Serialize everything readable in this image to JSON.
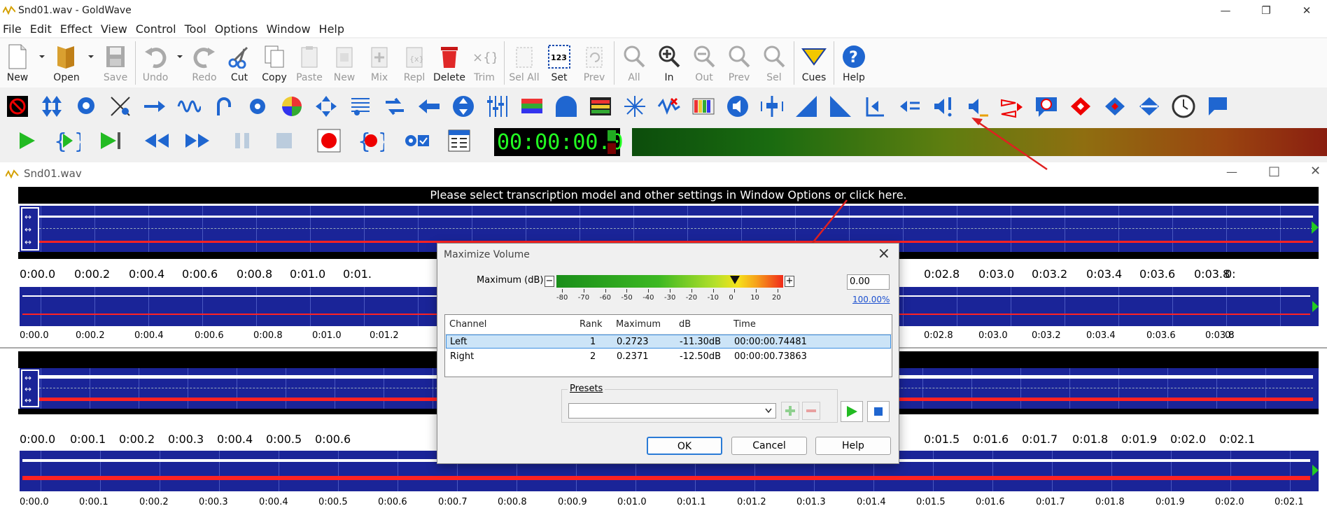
{
  "app": {
    "title": "Snd01.wav - GoldWave"
  },
  "menu": [
    "File",
    "Edit",
    "Effect",
    "View",
    "Control",
    "Tool",
    "Options",
    "Window",
    "Help"
  ],
  "toolbar": {
    "new": "New",
    "open": "Open",
    "save": "Save",
    "undo": "Undo",
    "redo": "Redo",
    "cut": "Cut",
    "copy": "Copy",
    "paste": "Paste",
    "new2": "New",
    "mix": "Mix",
    "repl": "Repl",
    "delete": "Delete",
    "trim": "Trim",
    "sel_all": "Sel All",
    "set": "Set",
    "prev": "Prev",
    "all": "All",
    "in": "In",
    "out": "Out",
    "prev2": "Prev",
    "sel": "Sel",
    "cues": "Cues",
    "help": "Help",
    "set_icon_text": "123"
  },
  "counter": {
    "time": "00:00:00.0"
  },
  "document": {
    "title": "Snd01.wav",
    "banner": "Please select transcription model and other settings in Window Options or click here."
  },
  "ruler1": [
    "0:00.0",
    "0:00.2",
    "0:00.4",
    "0:00.6",
    "0:00.8",
    "0:01.0",
    "0:01.",
    "0:02.8",
    "0:03.0",
    "0:03.2",
    "0:03.4",
    "0:03.6",
    "0:03.8",
    "0:"
  ],
  "ruler2": [
    "0:00.0",
    "0:00.2",
    "0:00.4",
    "0:00.6",
    "0:00.8",
    "0:01.0",
    "0:01.2",
    "0:02.8",
    "0:03.0",
    "0:03.2",
    "0:03.4",
    "0:03.6",
    "0:03.8",
    "0:"
  ],
  "ruler3": [
    "0:00.0",
    "0:00.1",
    "0:00.2",
    "0:00.3",
    "0:00.4",
    "0:00.5",
    "0:00.6",
    "0:01.5",
    "0:01.6",
    "0:01.7",
    "0:01.8",
    "0:01.9",
    "0:02.0",
    "0:02.1"
  ],
  "ruler4": [
    "0:00.0",
    "0:00.1",
    "0:00.2",
    "0:00.3",
    "0:00.4",
    "0:00.5",
    "0:00.6",
    "0:00.7",
    "0:00.8",
    "0:00.9",
    "0:01.0",
    "0:01.1",
    "0:01.2",
    "0:01.3",
    "0:01.4",
    "0:01.5",
    "0:01.6",
    "0:01.7",
    "0:01.8",
    "0:01.9",
    "0:02.0",
    "0:02.1"
  ],
  "dialog": {
    "title": "Maximize Volume",
    "max_label": "Maximum (dB):",
    "minus": "−",
    "plus": "+",
    "max_value": "0.00",
    "percent": "100.00%",
    "scale": [
      "-80",
      "-70",
      "-60",
      "-50",
      "-40",
      "-30",
      "-20",
      "-10",
      "0",
      "10",
      "20"
    ],
    "columns": [
      "Channel",
      "Rank",
      "Maximum",
      "dB",
      "Time"
    ],
    "rows": [
      {
        "channel": "Left",
        "rank": "1",
        "maximum": "0.2723",
        "db": "-11.30dB",
        "time": "00:00:00.74481",
        "selected": true
      },
      {
        "channel": "Right",
        "rank": "2",
        "maximum": "0.2371",
        "db": "-12.50dB",
        "time": "00:00:00.73863",
        "selected": false
      }
    ],
    "presets_label": "Presets",
    "preset_value": "",
    "ok": "OK",
    "cancel": "Cancel",
    "help": "Help"
  },
  "colors": {
    "wave_bg": "#1a2498",
    "left_channel": "#ffffff",
    "right_channel": "#ff2020",
    "arrow": "#e02020",
    "selection": "#cce4f7"
  }
}
